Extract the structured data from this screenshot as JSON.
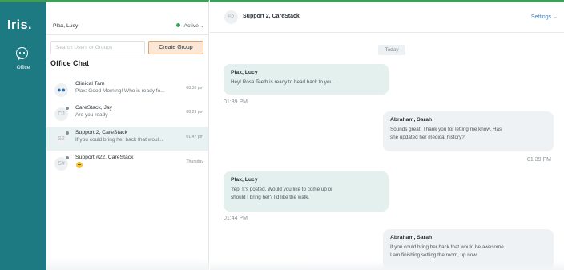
{
  "app": {
    "logo": "Iris."
  },
  "nav": {
    "items": [
      {
        "label": "Office",
        "icon": "chat-bubble-icon"
      }
    ]
  },
  "user": {
    "name": "Plax, Lucy",
    "status": "Active"
  },
  "search": {
    "placeholder": "Search Users or Groups",
    "value": ""
  },
  "create_group_label": "Create Group",
  "section_title": "Office Chat",
  "conversations": [
    {
      "avatar": "",
      "icon": "group-icon",
      "name": "Clinical Tam",
      "preview": "Plax: Good Morning! Who is ready fo...",
      "time": "08:36 pm"
    },
    {
      "avatar": "CJ",
      "name": "CareStack, Jay",
      "preview": "Are you ready",
      "time": "08:29 pm"
    },
    {
      "avatar": "S2",
      "name": "Support 2, CareStack",
      "preview": "If you could bring her back that woul...",
      "time": "01:47 pm"
    },
    {
      "avatar": "S#",
      "name": "Support #22, CareStack",
      "preview": "",
      "emoji": "grimace-emoji-icon",
      "time": "Thursday"
    }
  ],
  "chat": {
    "avatar": "S2",
    "title": "Support 2, CareStack",
    "settings_label": "Settings",
    "day_label": "Today",
    "messages": [
      {
        "sender": "Plax, Lucy",
        "text": "Hey!  Rosa Teeth is ready to head back to you.",
        "time": "01:39 PM",
        "direction": "incoming"
      },
      {
        "sender": "Abraham, Sarah",
        "text_lines": [
          "Sounds great! Thank you for letting me know. Has",
          "she updated her medical history?"
        ],
        "time": "01:39 PM",
        "direction": "outgoing"
      },
      {
        "sender": "Plax, Lucy",
        "text_lines": [
          "Yep. It's posted.  Would you like to come up or",
          "should I bring her?  I'd like the walk."
        ],
        "time": "01:44 PM",
        "direction": "incoming"
      },
      {
        "sender": "Abraham, Sarah",
        "text_lines": [
          "If you could bring her back that would be awesome.",
          "I am finishing setting the room, up now."
        ],
        "time": "",
        "direction": "outgoing"
      }
    ]
  },
  "colors": {
    "nav_bg": "#1d7a83",
    "accent_green": "#3f9e57",
    "create_btn_bg": "#fbe7d5",
    "create_btn_border": "#e0a36f",
    "incoming_bubble": "#e4f0ed",
    "outgoing_bubble": "#eef2f5",
    "link": "#3b7fbf"
  }
}
